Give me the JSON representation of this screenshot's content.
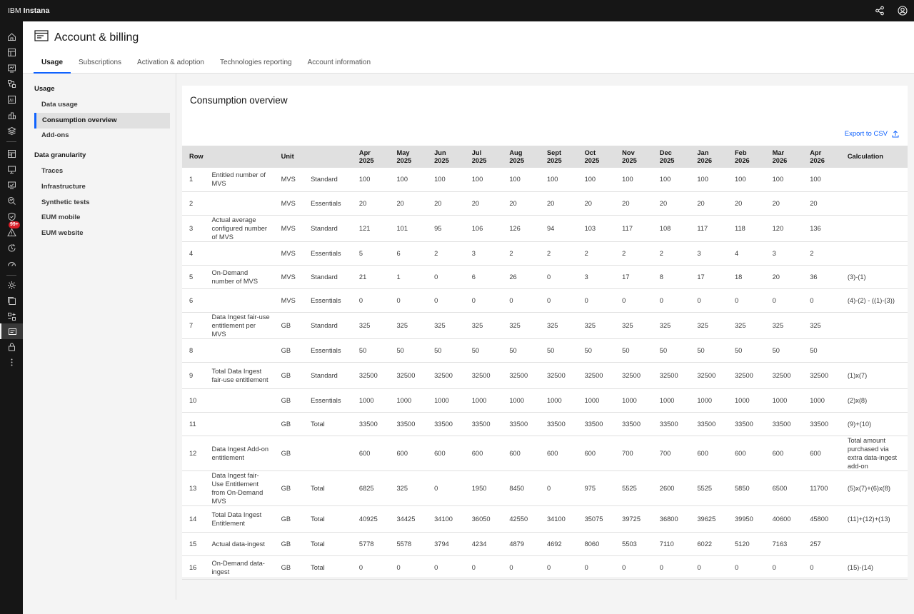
{
  "app": {
    "brand_prefix": "IBM",
    "brand_name": "Instana"
  },
  "page": {
    "title": "Account & billing"
  },
  "tabs": [
    {
      "label": "Usage",
      "active": true
    },
    {
      "label": "Subscriptions"
    },
    {
      "label": "Activation & adoption"
    },
    {
      "label": "Technologies reporting"
    },
    {
      "label": "Account information"
    }
  ],
  "subnav": {
    "usage_heading": "Usage",
    "usage_items": [
      "Data usage",
      "Consumption overview",
      "Add-ons"
    ],
    "granularity_heading": "Data granularity",
    "granularity_items": [
      "Traces",
      "Infrastructure",
      "Synthetic tests",
      "EUM mobile",
      "EUM website"
    ]
  },
  "rail": {
    "badge": "99+"
  },
  "panel": {
    "title": "Consumption overview",
    "export_label": "Export to CSV"
  },
  "table": {
    "headers": {
      "row": "Row",
      "unit": "Unit",
      "calculation": "Calculation"
    },
    "months": [
      [
        "Apr",
        "2025"
      ],
      [
        "May",
        "2025"
      ],
      [
        "Jun",
        "2025"
      ],
      [
        "Jul",
        "2025"
      ],
      [
        "Aug",
        "2025"
      ],
      [
        "Sept",
        "2025"
      ],
      [
        "Oct",
        "2025"
      ],
      [
        "Nov",
        "2025"
      ],
      [
        "Dec",
        "2025"
      ],
      [
        "Jan",
        "2026"
      ],
      [
        "Feb",
        "2026"
      ],
      [
        "Mar",
        "2026"
      ],
      [
        "Apr",
        "2026"
      ]
    ],
    "rows": [
      {
        "row": "1",
        "label": "Entitled number of MVS",
        "unit": "MVS",
        "type": "Standard",
        "values": [
          "100",
          "100",
          "100",
          "100",
          "100",
          "100",
          "100",
          "100",
          "100",
          "100",
          "100",
          "100",
          "100"
        ],
        "calc": ""
      },
      {
        "row": "2",
        "label": "",
        "unit": "MVS",
        "type": "Essentials",
        "values": [
          "20",
          "20",
          "20",
          "20",
          "20",
          "20",
          "20",
          "20",
          "20",
          "20",
          "20",
          "20",
          "20"
        ],
        "calc": ""
      },
      {
        "row": "3",
        "label": "Actual average configured number of MVS",
        "unit": "MVS",
        "type": "Standard",
        "values": [
          "121",
          "101",
          "95",
          "106",
          "126",
          "94",
          "103",
          "117",
          "108",
          "117",
          "118",
          "120",
          "136"
        ],
        "calc": ""
      },
      {
        "row": "4",
        "label": "",
        "unit": "MVS",
        "type": "Essentials",
        "values": [
          "5",
          "6",
          "2",
          "3",
          "2",
          "2",
          "2",
          "2",
          "2",
          "3",
          "4",
          "3",
          "2"
        ],
        "calc": ""
      },
      {
        "row": "5",
        "label": "On-Demand number of MVS",
        "unit": "MVS",
        "type": "Standard",
        "values": [
          "21",
          "1",
          "0",
          "6",
          "26",
          "0",
          "3",
          "17",
          "8",
          "17",
          "18",
          "20",
          "36"
        ],
        "calc": "(3)-(1)"
      },
      {
        "row": "6",
        "label": "",
        "unit": "MVS",
        "type": "Essentials",
        "values": [
          "0",
          "0",
          "0",
          "0",
          "0",
          "0",
          "0",
          "0",
          "0",
          "0",
          "0",
          "0",
          "0"
        ],
        "calc": "(4)-(2) - ((1)-(3))"
      },
      {
        "row": "7",
        "label": "Data Ingest fair-use entitlement per MVS",
        "unit": "GB",
        "type": "Standard",
        "values": [
          "325",
          "325",
          "325",
          "325",
          "325",
          "325",
          "325",
          "325",
          "325",
          "325",
          "325",
          "325",
          "325"
        ],
        "calc": ""
      },
      {
        "row": "8",
        "label": "",
        "unit": "GB",
        "type": "Essentials",
        "values": [
          "50",
          "50",
          "50",
          "50",
          "50",
          "50",
          "50",
          "50",
          "50",
          "50",
          "50",
          "50",
          "50"
        ],
        "calc": ""
      },
      {
        "row": "9",
        "label": "Total Data Ingest fair-use entitlement",
        "unit": "GB",
        "type": "Standard",
        "values": [
          "32500",
          "32500",
          "32500",
          "32500",
          "32500",
          "32500",
          "32500",
          "32500",
          "32500",
          "32500",
          "32500",
          "32500",
          "32500"
        ],
        "calc": "(1)x(7)"
      },
      {
        "row": "10",
        "label": "",
        "unit": "GB",
        "type": "Essentials",
        "values": [
          "1000",
          "1000",
          "1000",
          "1000",
          "1000",
          "1000",
          "1000",
          "1000",
          "1000",
          "1000",
          "1000",
          "1000",
          "1000"
        ],
        "calc": "(2)x(8)"
      },
      {
        "row": "11",
        "label": "",
        "unit": "GB",
        "type": "Total",
        "values": [
          "33500",
          "33500",
          "33500",
          "33500",
          "33500",
          "33500",
          "33500",
          "33500",
          "33500",
          "33500",
          "33500",
          "33500",
          "33500"
        ],
        "calc": "(9)+(10)"
      },
      {
        "row": "12",
        "label": "Data Ingest Add-on entitlement",
        "unit": "GB",
        "type": "",
        "values": [
          "600",
          "600",
          "600",
          "600",
          "600",
          "600",
          "600",
          "700",
          "700",
          "600",
          "600",
          "600",
          "600"
        ],
        "calc": "Total amount purchased via extra data-ingest add-on"
      },
      {
        "row": "13",
        "label": "Data Ingest fair-Use Entitlement from On-Demand MVS",
        "unit": "GB",
        "type": "Total",
        "values": [
          "6825",
          "325",
          "0",
          "1950",
          "8450",
          "0",
          "975",
          "5525",
          "2600",
          "5525",
          "5850",
          "6500",
          "11700"
        ],
        "calc": "(5)x(7)+(6)x(8)"
      },
      {
        "row": "14",
        "label": "Total Data Ingest Entitlement",
        "unit": "GB",
        "type": "Total",
        "values": [
          "40925",
          "34425",
          "34100",
          "36050",
          "42550",
          "34100",
          "35075",
          "39725",
          "36800",
          "39625",
          "39950",
          "40600",
          "45800"
        ],
        "calc": "(11)+(12)+(13)"
      },
      {
        "row": "15",
        "label": "Actual data-ingest",
        "unit": "GB",
        "type": "Total",
        "values": [
          "5778",
          "5578",
          "3794",
          "4234",
          "4879",
          "4692",
          "8060",
          "5503",
          "7110",
          "6022",
          "5120",
          "7163",
          "257"
        ],
        "calc": ""
      },
      {
        "row": "16",
        "label": "On-Demand data-ingest",
        "unit": "GB",
        "type": "Total",
        "values": [
          "0",
          "0",
          "0",
          "0",
          "0",
          "0",
          "0",
          "0",
          "0",
          "0",
          "0",
          "0",
          "0"
        ],
        "calc": "(15)-(14)"
      }
    ]
  }
}
